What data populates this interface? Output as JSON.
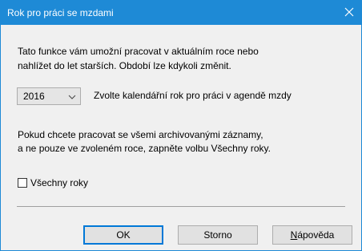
{
  "window": {
    "title": "Rok pro práci se mzdami",
    "accent_color": "#1e8ad6",
    "close_icon": "close-icon"
  },
  "intro": {
    "line1": "Tato funkce vám umožní pracovat v aktuálním roce nebo",
    "line2": "nahlížet do let starších. Období lze kdykoli změnit."
  },
  "year_select": {
    "value": "2016",
    "label": "Zvolte kalendářní rok pro práci v agendě mzdy"
  },
  "archive": {
    "line1": "Pokud chcete pracovat se všemi archivovanými záznamy,",
    "line2": "a ne pouze ve zvoleném roce, zapněte volbu Všechny roky."
  },
  "all_years_checkbox": {
    "label": "Všechny roky",
    "checked": false
  },
  "buttons": {
    "ok": "OK",
    "cancel": "Storno",
    "help_first": "N",
    "help_rest": "ápověda"
  }
}
